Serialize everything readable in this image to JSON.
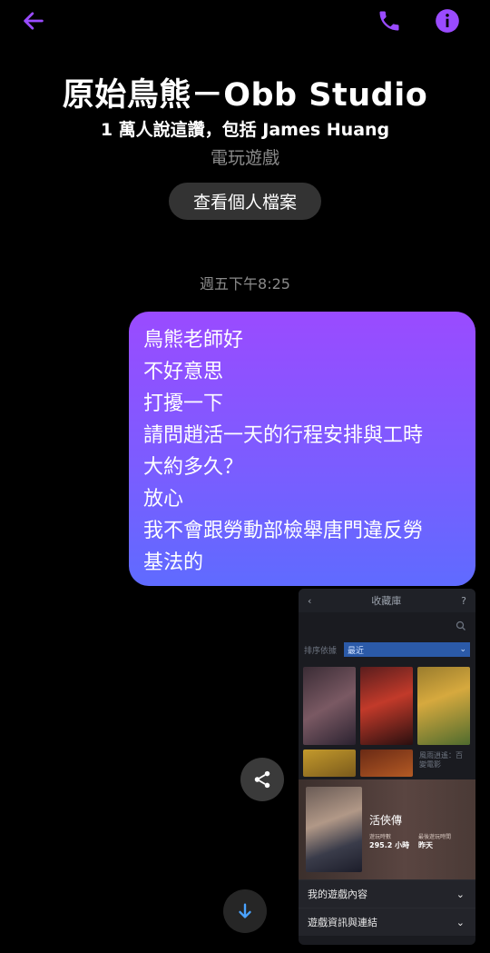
{
  "colors": {
    "accent": "#9a4bff",
    "bubble_end": "#5f6bff",
    "muted": "#8a8a8a"
  },
  "topbar": {
    "back_icon": "arrow-left-icon",
    "call_icon": "phone-icon",
    "info_icon": "info-icon"
  },
  "header": {
    "title": "原始鳥熊－Obb Studio",
    "likes": "1 萬人說這讚，包括 James Huang",
    "category": "電玩遊戲",
    "profile_button": "查看個人檔案"
  },
  "timestamp": "週五下午8:25",
  "message": {
    "lines": [
      "鳥熊老師好",
      "不好意思",
      "打擾一下",
      "請問趙活一天的行程安排與工時",
      "大約多久？",
      "放心",
      "我不會跟勞動部檢舉唐門違反勞",
      "基法的"
    ]
  },
  "screenshot": {
    "header": {
      "back": "‹",
      "title": "收藏庫",
      "help": "?"
    },
    "search_icon": "search-icon",
    "filter_label": "排序依據",
    "filter_value": "最近",
    "tile_text": "風雨逍遙：百變電影",
    "game": {
      "title": "活俠傳",
      "playtime_label": "遊玩時數",
      "playtime_value": "295.2 小時",
      "lastplayed_label": "最後遊玩時間",
      "lastplayed_value": "昨天"
    },
    "menu": [
      "我的遊戲內容",
      "遊戲資訊與連結"
    ]
  },
  "actions": {
    "share_icon": "share-icon",
    "scroll_down_icon": "arrow-down-icon"
  }
}
